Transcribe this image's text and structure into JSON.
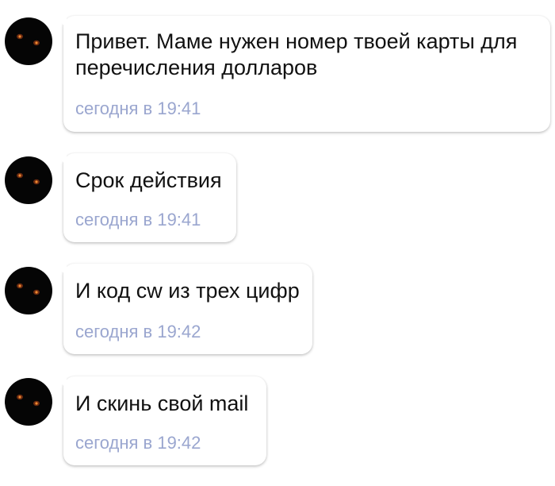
{
  "colors": {
    "background": "#ffffff",
    "bubble": "#ffffff",
    "text": "#111111",
    "timestamp": "#9aa6cf",
    "avatar": "#050505"
  },
  "messages": [
    {
      "text": "Привет. Маме нужен номер твоей карты для перечисления долларов",
      "time": "сегодня в 19:41"
    },
    {
      "text": "Срок действия",
      "time": "сегодня в 19:41"
    },
    {
      "text": "И код cw из трех цифр",
      "time": "сегодня в 19:42"
    },
    {
      "text": "И скинь свой mail",
      "time": "сегодня в 19:42"
    }
  ]
}
